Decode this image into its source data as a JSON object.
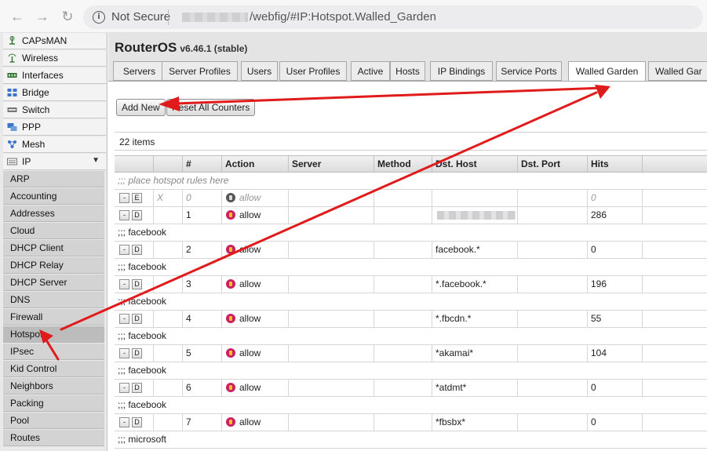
{
  "browser": {
    "security_label": "Not Secure",
    "url_path": "/webfig/#IP:Hotspot.Walled_Garden",
    "back_glyph": "←",
    "forward_glyph": "→",
    "reload_glyph": "↻",
    "info_glyph": "i"
  },
  "sidebar": {
    "items": [
      {
        "label": "CAPsMAN",
        "icon": "capsman-icon"
      },
      {
        "label": "Wireless",
        "icon": "wireless-icon"
      },
      {
        "label": "Interfaces",
        "icon": "interfaces-icon"
      },
      {
        "label": "Bridge",
        "icon": "bridge-icon"
      },
      {
        "label": "Switch",
        "icon": "switch-icon"
      },
      {
        "label": "PPP",
        "icon": "ppp-icon"
      },
      {
        "label": "Mesh",
        "icon": "mesh-icon"
      },
      {
        "label": "IP",
        "icon": "ip-icon",
        "expanded_glyph": "▼"
      }
    ],
    "sub_items": [
      "ARP",
      "Accounting",
      "Addresses",
      "Cloud",
      "DHCP Client",
      "DHCP Relay",
      "DHCP Server",
      "DNS",
      "Firewall",
      "Hotspot",
      "IPsec",
      "Kid Control",
      "Neighbors",
      "Packing",
      "Pool",
      "Routes"
    ],
    "active_sub_item": "Hotspot"
  },
  "header": {
    "product": "RouterOS",
    "version": "v6.46.1 (stable)"
  },
  "tabs": [
    "Servers",
    "Server Profiles",
    "Users",
    "User Profiles",
    "Active",
    "Hosts",
    "IP Bindings",
    "Service Ports",
    "Walled Garden",
    "Walled Gar"
  ],
  "active_tab": "Walled Garden",
  "toolbar": {
    "add_new": "Add New",
    "reset_counters": "Reset All Counters"
  },
  "item_count": "22 items",
  "table": {
    "columns": [
      "",
      "",
      "#",
      "Action",
      "Server",
      "Method",
      "Dst. Host",
      "Dst. Port",
      "Hits"
    ],
    "rows": [
      {
        "kind": "comment",
        "text": ";;; place hotspot rules here",
        "italic": true
      },
      {
        "kind": "entry",
        "disabled_btn": "-",
        "edit_btn": "E",
        "flag": "X",
        "num": "0",
        "action": "allow",
        "dst_host": "",
        "dst_port": "",
        "hits": "0",
        "muted": true
      },
      {
        "kind": "entry",
        "disabled_btn": "-",
        "edit_btn": "D",
        "flag": "",
        "num": "1",
        "action": "allow",
        "dst_host": "",
        "dst_port": "",
        "hits": "286",
        "redacted": true
      },
      {
        "kind": "comment",
        "text": ";;; facebook"
      },
      {
        "kind": "entry",
        "disabled_btn": "-",
        "edit_btn": "D",
        "flag": "",
        "num": "2",
        "action": "allow",
        "dst_host": "facebook.*",
        "dst_port": "",
        "hits": "0"
      },
      {
        "kind": "comment",
        "text": ";;; facebook"
      },
      {
        "kind": "entry",
        "disabled_btn": "-",
        "edit_btn": "D",
        "flag": "",
        "num": "3",
        "action": "allow",
        "dst_host": "*.facebook.*",
        "dst_port": "",
        "hits": "196"
      },
      {
        "kind": "comment",
        "text": ";;; facebook"
      },
      {
        "kind": "entry",
        "disabled_btn": "-",
        "edit_btn": "D",
        "flag": "",
        "num": "4",
        "action": "allow",
        "dst_host": "*.fbcdn.*",
        "dst_port": "",
        "hits": "55"
      },
      {
        "kind": "comment",
        "text": ";;; facebook"
      },
      {
        "kind": "entry",
        "disabled_btn": "-",
        "edit_btn": "D",
        "flag": "",
        "num": "5",
        "action": "allow",
        "dst_host": "*akamai*",
        "dst_port": "",
        "hits": "104"
      },
      {
        "kind": "comment",
        "text": ";;; facebook"
      },
      {
        "kind": "entry",
        "disabled_btn": "-",
        "edit_btn": "D",
        "flag": "",
        "num": "6",
        "action": "allow",
        "dst_host": "*atdmt*",
        "dst_port": "",
        "hits": "0"
      },
      {
        "kind": "comment",
        "text": ";;; facebook"
      },
      {
        "kind": "entry",
        "disabled_btn": "-",
        "edit_btn": "D",
        "flag": "",
        "num": "7",
        "action": "allow",
        "dst_host": "*fbsbx*",
        "dst_port": "",
        "hits": "0"
      },
      {
        "kind": "comment",
        "text": ";;; microsoft"
      }
    ]
  },
  "colors": {
    "arrow": "#e01b1b",
    "allow_icon": "#cc1f66"
  }
}
